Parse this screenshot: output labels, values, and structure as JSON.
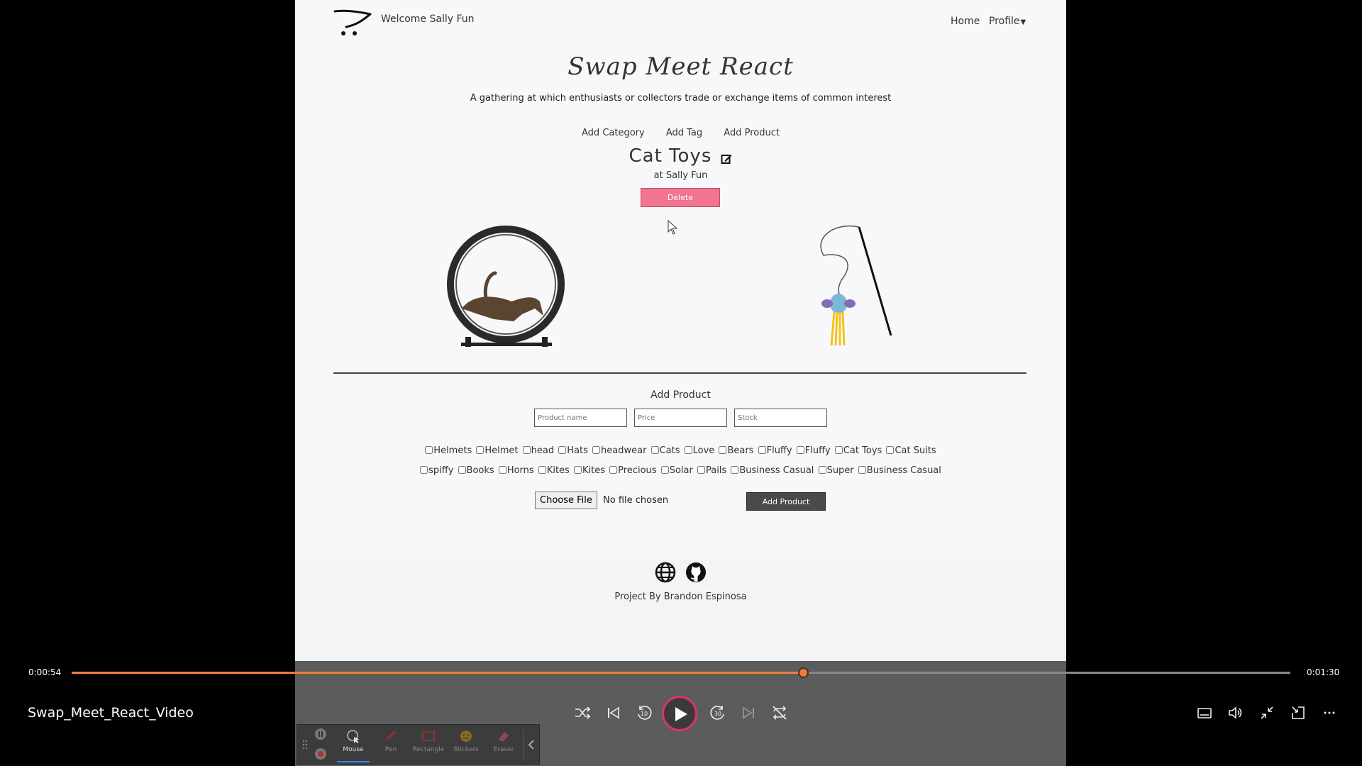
{
  "page": {
    "welcome": "Welcome Sally Fun",
    "nav": {
      "home": "Home",
      "profile": "Profile"
    },
    "site_title": "Swap Meet React",
    "tagline": "A gathering at which enthusiasts or collectors trade or exchange items of common interest",
    "admin_links": {
      "add_category": "Add Category",
      "add_tag": "Add Tag",
      "add_product": "Add Product"
    },
    "category": {
      "title": "Cat Toys",
      "owner": "at Sally Fun",
      "delete_label": "Delete"
    },
    "products": [
      {
        "image_icon": "cat-wheel-image"
      },
      {
        "image_icon": "cat-wand-toy-image"
      }
    ],
    "add_product_form": {
      "heading": "Add Product",
      "name_placeholder": "Product name",
      "price_placeholder": "Price",
      "stock_placeholder": "Stock",
      "tags_row_1": [
        "Helmets",
        "Helmet",
        "head",
        "Hats",
        "headwear",
        "Cats",
        "Love",
        "Bears",
        "Fluffy",
        "Fluffy",
        "Cat Toys",
        "Cat Suits"
      ],
      "tags_row_2": [
        "spiffy",
        "Books",
        "Horns",
        "Kites",
        "Kites",
        "Precious",
        "Solar",
        "Pails",
        "Business Casual",
        "Super",
        "Business Casual"
      ],
      "choose_file_label": "Choose File",
      "no_file_text": "No file chosen",
      "submit_label": "Add Product"
    },
    "footer": {
      "credit": "Project By Brandon Espinosa",
      "icons": [
        "globe-icon",
        "github-icon"
      ]
    }
  },
  "player": {
    "time_current": "0:00:54",
    "time_total": "0:01:30",
    "progress_fraction": 0.6,
    "video_title": "Swap_Meet_React_Video",
    "accent": "#f47a38",
    "controls": [
      "shuffle-icon",
      "previous-icon",
      "rewind-10-icon",
      "play-icon",
      "forward-30-icon",
      "next-icon",
      "repeat-off-icon"
    ],
    "right_controls": [
      "captions-icon",
      "volume-icon",
      "minimize-icon",
      "miniplayer-icon",
      "more-icon"
    ]
  },
  "annotation_toolbar": {
    "tools": [
      "Mouse",
      "Pen",
      "Rectangle",
      "Stickers",
      "Eraser"
    ]
  }
}
